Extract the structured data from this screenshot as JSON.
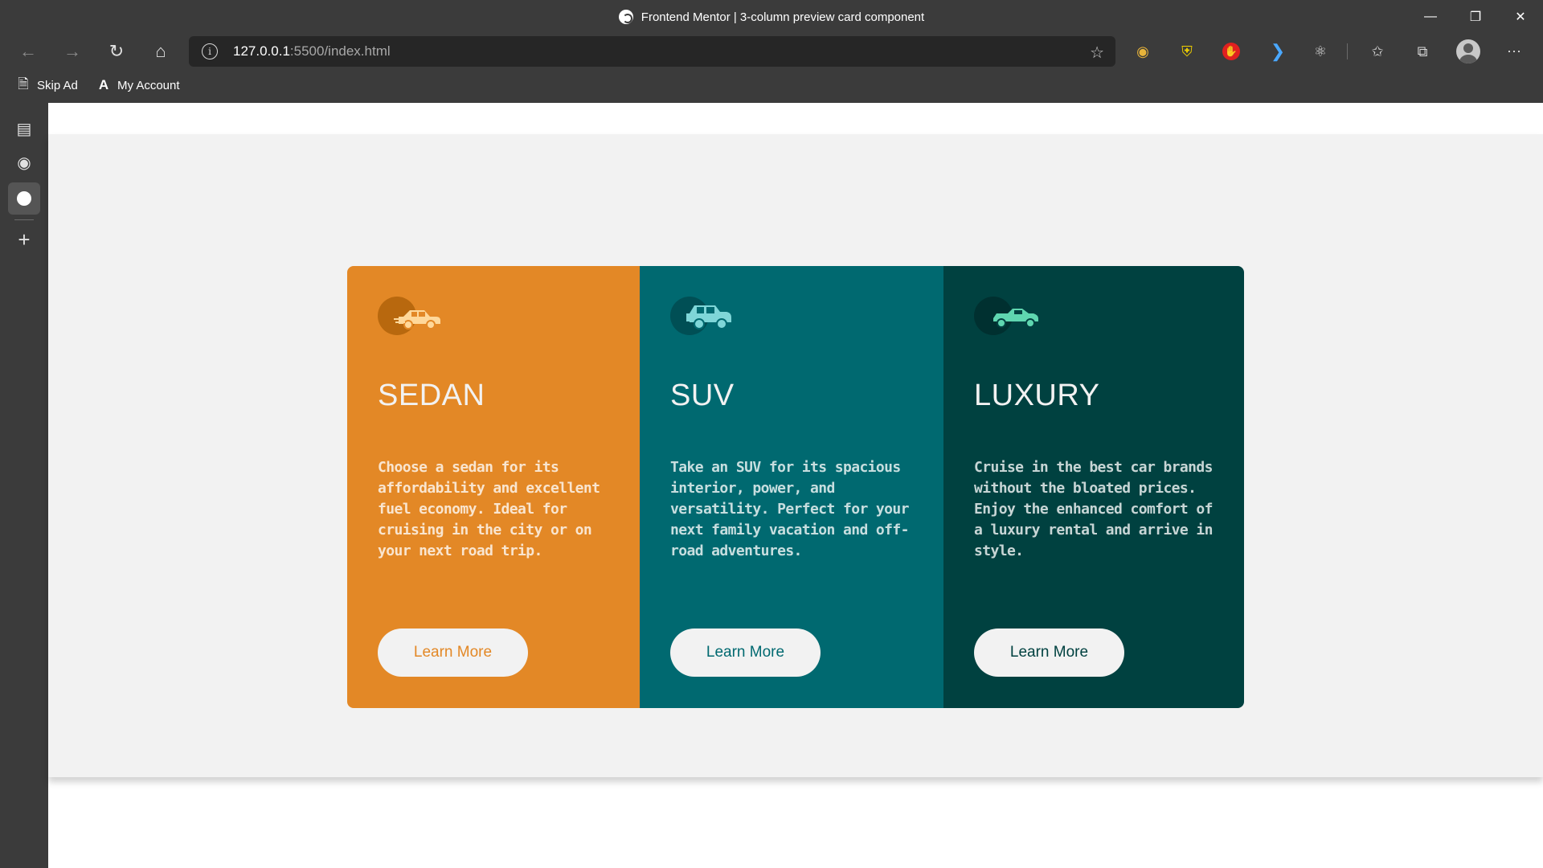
{
  "browser": {
    "window_title": "Frontend Mentor | 3-column preview card component",
    "url_host": "127.0.0.1",
    "url_rest": ":5500/index.html",
    "favorites": [
      {
        "label": "Skip Ad",
        "icon": "page-icon"
      },
      {
        "label": "My Account",
        "icon": "angular-icon"
      }
    ],
    "nav_icons": [
      "back-icon",
      "forward-icon",
      "refresh-icon",
      "home-icon"
    ],
    "extension_icons": [
      "chrome-ext-icon",
      "shield-ext-icon",
      "hand-ext-icon",
      "chevron-ext-icon",
      "react-ext-icon",
      "favorites-icon",
      "collections-icon",
      "profile-avatar",
      "more-icon"
    ],
    "sidebar_icons": [
      "tab-icon",
      "github-icon",
      "frontend-mentor-icon",
      "add-icon"
    ]
  },
  "cards": [
    {
      "id": "sedan",
      "title": "SEDAN",
      "description": "Choose a sedan for its affordability and excellent fuel economy. Ideal for cruising in the city or on your next road trip.",
      "button": "Learn More",
      "icon": "sedan-icon",
      "bg_color": "#e38826"
    },
    {
      "id": "suv",
      "title": "SUV",
      "description": "Take an SUV for its spacious interior, power, and versatility. Perfect for your next family vacation and off-road adventures.",
      "button": "Learn More",
      "icon": "suv-icon",
      "bg_color": "#006970"
    },
    {
      "id": "luxury",
      "title": "LUXURY",
      "description": "Cruise in the best car brands without the bloated prices. Enjoy the enhanced comfort of a luxury rental and arrive in style.",
      "button": "Learn More",
      "icon": "luxury-icon",
      "bg_color": "#004140"
    }
  ]
}
